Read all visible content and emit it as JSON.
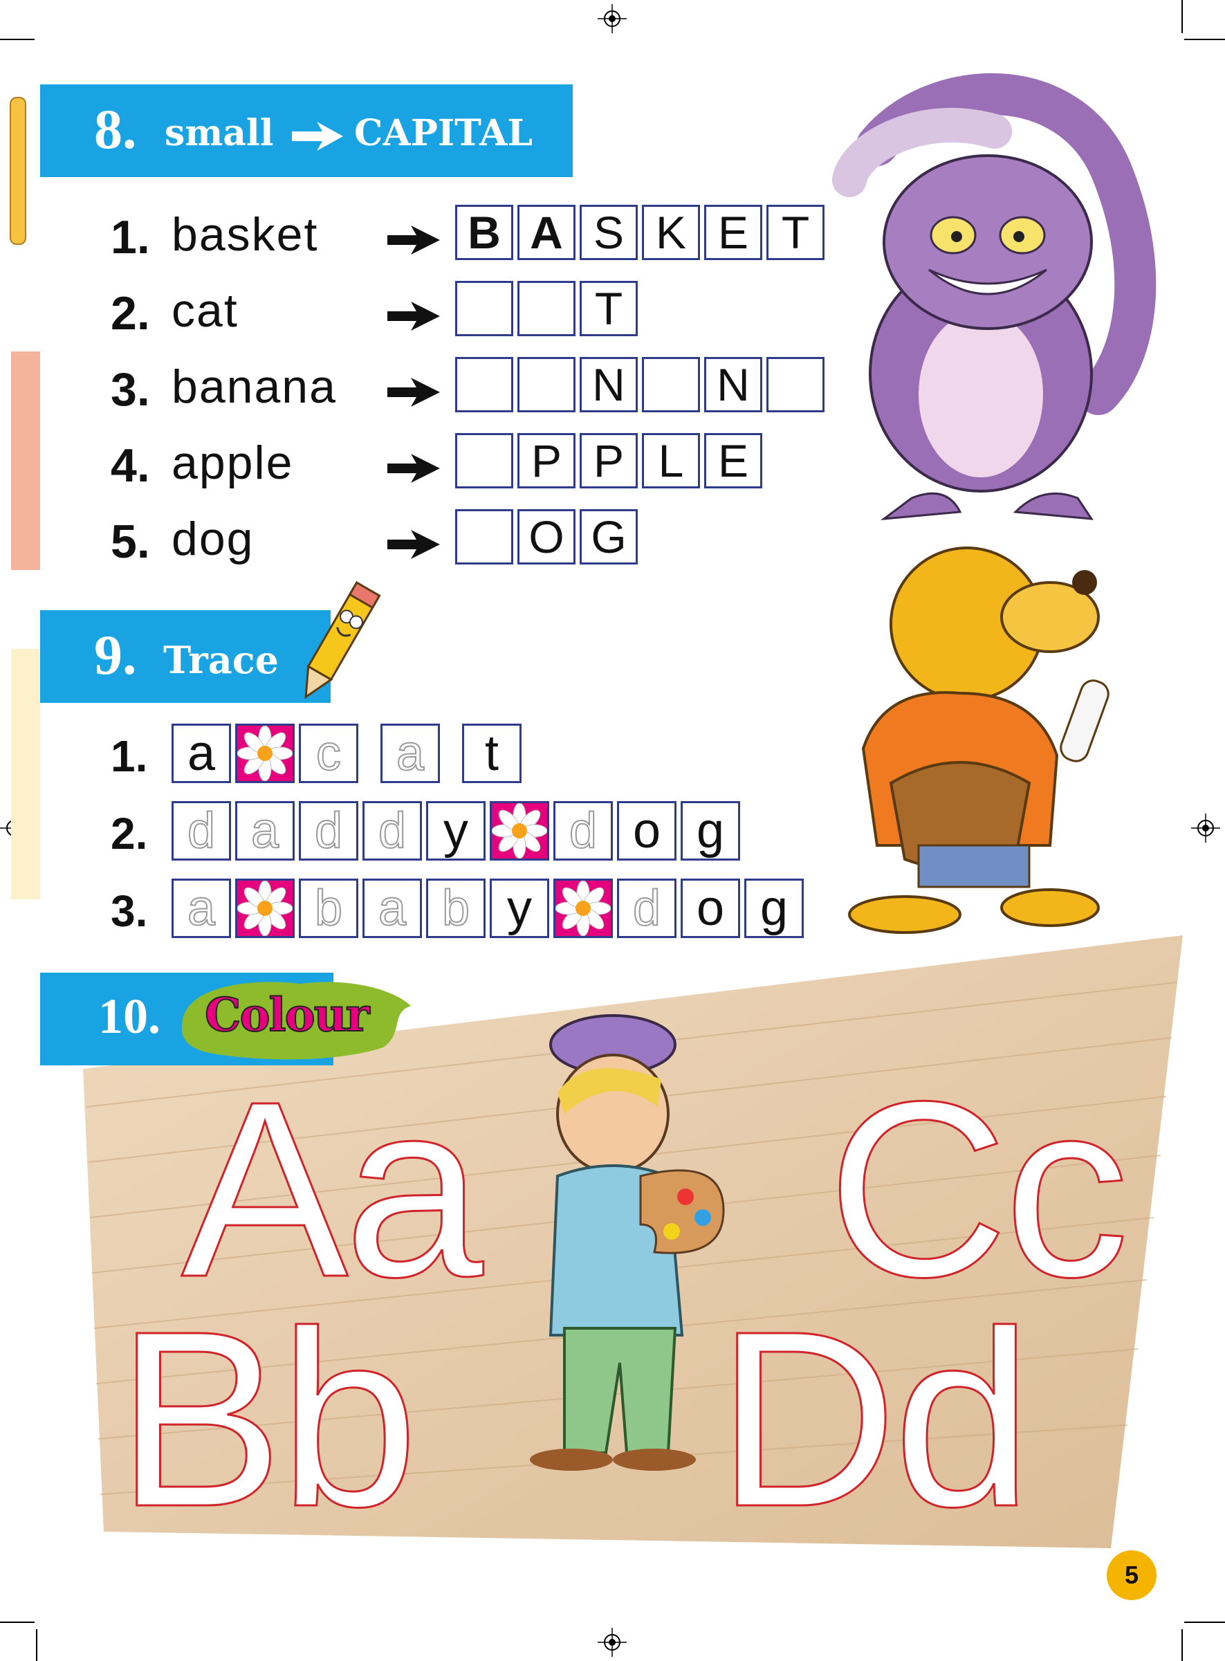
{
  "colors": {
    "header_blue": "#1aa3e3",
    "box_border": "#2f3c8c",
    "flower_pink": "#e6007e",
    "trace_red": "#d0232a",
    "wood": "#e8cfb0"
  },
  "ex8": {
    "number": "8.",
    "title_small": "small",
    "title_capital": "CAPITAL",
    "rows": [
      {
        "num": "1.",
        "word": "basket",
        "boxes": [
          "B",
          "A",
          "S",
          "K",
          "E",
          "T"
        ]
      },
      {
        "num": "2.",
        "word": "cat",
        "boxes": [
          "",
          "",
          "T"
        ]
      },
      {
        "num": "3.",
        "word": "banana",
        "boxes": [
          "",
          "",
          "N",
          "",
          "N",
          ""
        ]
      },
      {
        "num": "4.",
        "word": "apple",
        "boxes": [
          "",
          "P",
          "P",
          "L",
          "E"
        ]
      },
      {
        "num": "5.",
        "word": "dog",
        "boxes": [
          "",
          "O",
          "G"
        ]
      }
    ]
  },
  "ex9": {
    "number": "9.",
    "title": "Trace",
    "rows": [
      {
        "num": "1.",
        "cells": [
          "a",
          "*",
          "c",
          " ",
          "a",
          " ",
          "t"
        ]
      },
      {
        "num": "2.",
        "cells": [
          "d",
          "a",
          "d",
          "d",
          "y",
          "*",
          "d",
          "o",
          "g"
        ]
      },
      {
        "num": "3.",
        "cells": [
          "a",
          "*",
          "b",
          "a",
          "b",
          "y",
          "*",
          "d",
          "o",
          "g"
        ]
      }
    ]
  },
  "ex10": {
    "number": "10.",
    "title": "Colour",
    "letters": [
      "Aa",
      "Cc",
      "Bb",
      "Dd"
    ]
  },
  "page_number": "5"
}
